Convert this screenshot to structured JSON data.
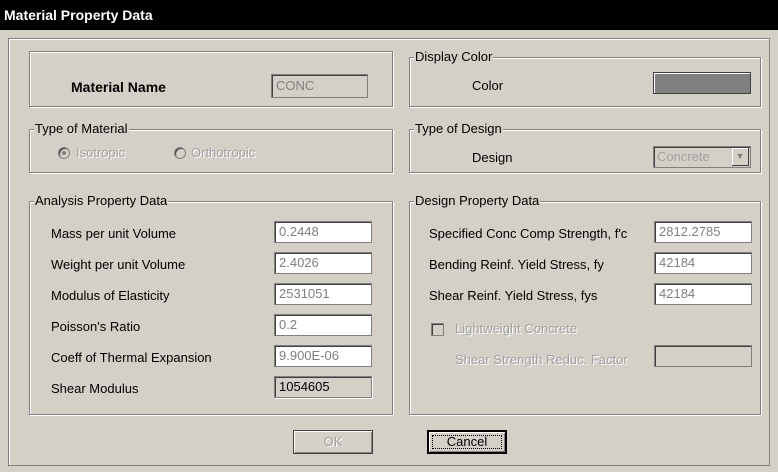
{
  "window": {
    "title": "Material Property Data"
  },
  "material_name": {
    "label": "Material Name",
    "value": "CONC"
  },
  "display_color": {
    "group_label": "Display Color",
    "label": "Color",
    "color": "#808080"
  },
  "type_of_material": {
    "group_label": "Type of Material",
    "options": [
      "Isotropic",
      "Orthotropic"
    ],
    "selected": "Isotropic"
  },
  "type_of_design": {
    "group_label": "Type of Design",
    "label": "Design",
    "value": "Concrete"
  },
  "analysis": {
    "group_label": "Analysis Property Data",
    "rows": [
      {
        "label": "Mass per unit Volume",
        "value": "0.2448"
      },
      {
        "label": "Weight per unit Volume",
        "value": "2.4026"
      },
      {
        "label": "Modulus of Elasticity",
        "value": "2531051"
      },
      {
        "label": "Poisson's Ratio",
        "value": "0.2"
      },
      {
        "label": "Coeff of Thermal Expansion",
        "value": "9.900E-06"
      },
      {
        "label": "Shear Modulus",
        "value": "1054605"
      }
    ]
  },
  "design": {
    "group_label": "Design Property Data",
    "rows": [
      {
        "label": "Specified Conc Comp Strength, f'c",
        "value": "2812.2785"
      },
      {
        "label": "Bending Reinf. Yield Stress, fy",
        "value": "42184"
      },
      {
        "label": "Shear Reinf. Yield Stress, fys",
        "value": "42184"
      }
    ],
    "lightweight_label": "Lightweight Concrete",
    "shear_reduc_label": "Shear Strength Reduc. Factor",
    "shear_reduc_value": ""
  },
  "buttons": {
    "ok": "OK",
    "cancel": "Cancel"
  }
}
